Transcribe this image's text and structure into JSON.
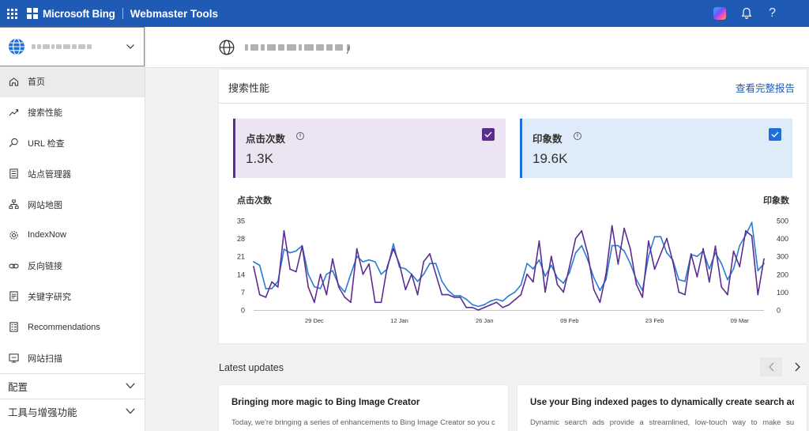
{
  "topbar": {
    "brand": "Microsoft Bing",
    "product": "Webmaster Tools",
    "help_glyph": "?",
    "icons": [
      "app-launcher-icon",
      "microsoft-logo-icon",
      "copilot-icon",
      "bell-icon",
      "help-icon"
    ]
  },
  "sidebar": {
    "site_selector_icon": "globe-icon",
    "items": [
      {
        "label": "首页",
        "icon": "home-icon",
        "active": true
      },
      {
        "label": "搜索性能",
        "icon": "trend-icon"
      },
      {
        "label": "URL 检查",
        "icon": "search-icon"
      },
      {
        "label": "站点管理器",
        "icon": "list-icon"
      },
      {
        "label": "网站地图",
        "icon": "sitemap-icon"
      },
      {
        "label": "IndexNow",
        "icon": "gear-icon"
      },
      {
        "label": "反向链接",
        "icon": "link-icon"
      },
      {
        "label": "关键字研究",
        "icon": "document-icon"
      },
      {
        "label": "Recommendations",
        "icon": "checklist-icon"
      },
      {
        "label": "网站扫描",
        "icon": "scan-icon"
      }
    ],
    "sections": [
      {
        "label": "配置"
      },
      {
        "label": "工具与增强功能"
      }
    ]
  },
  "header": {
    "slash": "/"
  },
  "performance": {
    "title": "搜索性能",
    "link": "查看完整报告",
    "metrics": {
      "clicks": {
        "label": "点击次数",
        "value": "1.3K",
        "color": "#5c2d91",
        "checked": true
      },
      "impressions": {
        "label": "印象数",
        "value": "19.6K",
        "color": "#1e6fd9",
        "checked": true
      }
    },
    "info_glyph": "i"
  },
  "chart_data": {
    "type": "line",
    "left_axis_title": "点击次数",
    "right_axis_title": "印象数",
    "ylim_left": [
      0,
      35
    ],
    "yticks_left": [
      0,
      7,
      14,
      21,
      28,
      35
    ],
    "ylim_right": [
      0,
      500
    ],
    "yticks_right": [
      0,
      100,
      200,
      300,
      400,
      500
    ],
    "x_tick_labels": [
      "29 Dec",
      "12 Jan",
      "26 Jan",
      "09 Feb",
      "23 Feb",
      "09 Mar"
    ],
    "x_tick_index": [
      10,
      24,
      38,
      52,
      66,
      80
    ],
    "grid": false,
    "series": [
      {
        "name": "点击次数",
        "axis": "left",
        "color": "#5c2d91",
        "values": [
          17,
          6,
          5,
          11,
          9,
          31,
          16,
          15,
          25,
          9,
          3,
          14,
          6,
          20,
          9,
          5,
          3,
          24,
          14,
          18,
          3,
          3,
          17,
          24,
          18,
          8,
          14,
          6,
          19,
          22,
          14,
          6,
          6,
          5,
          5,
          1,
          1,
          0,
          1,
          2,
          3,
          1,
          2,
          4,
          6,
          14,
          11,
          27,
          7,
          21,
          10,
          7,
          17,
          28,
          31,
          22,
          8,
          3,
          14,
          33,
          18,
          32,
          24,
          10,
          5,
          27,
          16,
          22,
          28,
          19,
          7,
          6,
          22,
          13,
          24,
          11,
          25,
          9,
          6,
          23,
          17,
          31,
          29,
          6,
          20
        ]
      },
      {
        "name": "印象数",
        "axis": "right",
        "color": "#2b7cd3",
        "values": [
          270,
          250,
          120,
          120,
          160,
          340,
          320,
          330,
          360,
          200,
          130,
          120,
          200,
          220,
          140,
          100,
          200,
          300,
          270,
          280,
          270,
          200,
          230,
          370,
          240,
          230,
          200,
          160,
          200,
          260,
          260,
          160,
          110,
          80,
          80,
          60,
          30,
          20,
          30,
          50,
          60,
          50,
          80,
          100,
          140,
          260,
          230,
          280,
          190,
          250,
          180,
          150,
          210,
          320,
          360,
          280,
          180,
          110,
          170,
          360,
          360,
          330,
          260,
          170,
          110,
          300,
          410,
          410,
          320,
          280,
          170,
          160,
          310,
          300,
          330,
          230,
          320,
          260,
          170,
          230,
          360,
          420,
          490,
          220,
          260
        ]
      }
    ]
  },
  "updates": {
    "title": "Latest updates",
    "cards": [
      {
        "title": "Bringing more magic to Bing Image Creator",
        "body": "Today, we're bringing a series of enhancements to Bing Image Creator so you can"
      },
      {
        "title": "Use your Bing indexed pages to dynamically create search ads",
        "body": "Dynamic search ads provide a streamlined, low-touch way to make sure"
      }
    ]
  }
}
